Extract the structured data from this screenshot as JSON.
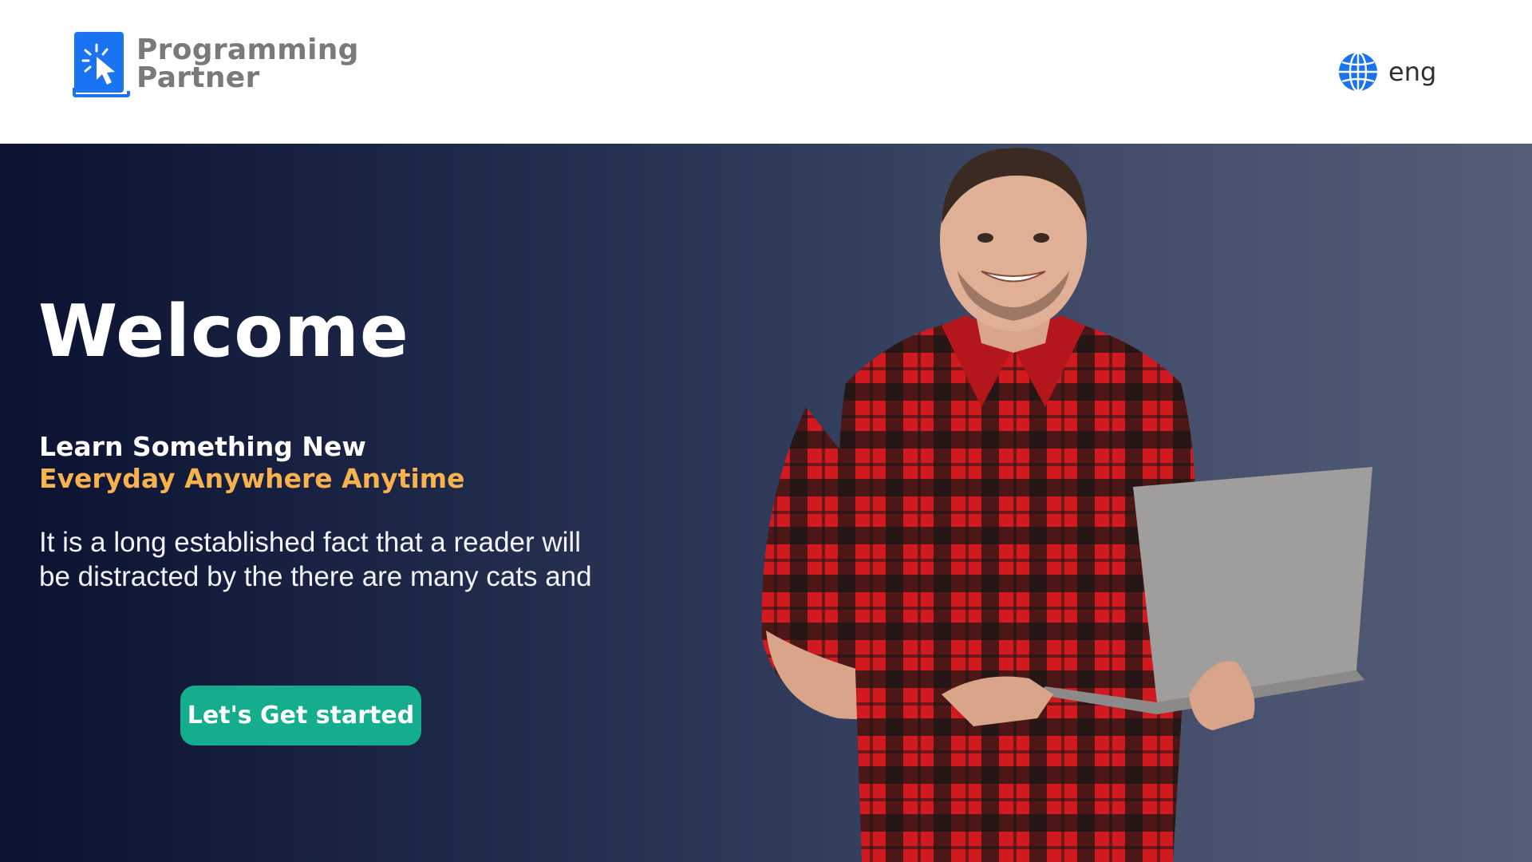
{
  "header": {
    "logo": {
      "line1": "Programming",
      "line2": "Partner",
      "icon": "cursor-click-icon"
    },
    "language": {
      "label": "eng",
      "icon": "globe-icon"
    }
  },
  "hero": {
    "title": "Welcome",
    "tagline_line1": "Learn Something New",
    "tagline_line2": "Everyday Anywhere Anytime",
    "body_line1": "It is a long established fact that a reader will",
    "body_line2": "be distracted by the there are many cats and",
    "cta_label": "Let's Get started"
  },
  "colors": {
    "brand_blue": "#1a73f0",
    "logo_gray": "#7a7a7a",
    "accent_orange": "#f7b24e",
    "cta_green": "#14ad8e",
    "hero_dark": "#0b1231",
    "hero_light": "#555e78"
  },
  "image": {
    "hero_photo": "smiling man in red plaid shirt holding a laptop"
  }
}
